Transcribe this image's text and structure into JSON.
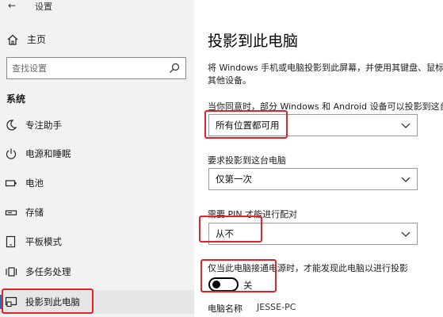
{
  "window": {
    "title": "设置",
    "back_icon": "back-arrow-icon"
  },
  "sidebar": {
    "home_label": "主页",
    "search_placeholder": "查找设置",
    "section_title": "系统",
    "items": [
      {
        "label": "专注助手",
        "icon": "moon-icon"
      },
      {
        "label": "电源和睡眠",
        "icon": "power-icon"
      },
      {
        "label": "电池",
        "icon": "battery-icon"
      },
      {
        "label": "存储",
        "icon": "storage-icon"
      },
      {
        "label": "平板模式",
        "icon": "tablet-icon"
      },
      {
        "label": "多任务处理",
        "icon": "multitask-icon"
      },
      {
        "label": "投影到此电脑",
        "icon": "project-icon",
        "active": true
      }
    ]
  },
  "main": {
    "title": "投影到此电脑",
    "description": "将 Windows 手机或电脑投影到此屏幕，并使用其键盘、鼠标和其他设备。",
    "q1_label": "当你同意时，部分 Windows 和 Android 设备可以投影到这台电脑",
    "q1_value": "所有位置都可用",
    "q2_label": "要求投影到这台电脑",
    "q2_value": "仅第一次",
    "q3_label": "需要 PIN 才能进行配对",
    "q3_value": "从不",
    "q4_label": "仅当此电脑接通电源时，才能发现此电脑以进行投影",
    "toggle_state": "关",
    "pc_name_label": "电脑名称",
    "pc_name_value": "JESSE-PC"
  },
  "colors": {
    "accent": "#0078d4",
    "highlight": "#e0242a",
    "sidebar_bg": "#f2f2f2"
  }
}
